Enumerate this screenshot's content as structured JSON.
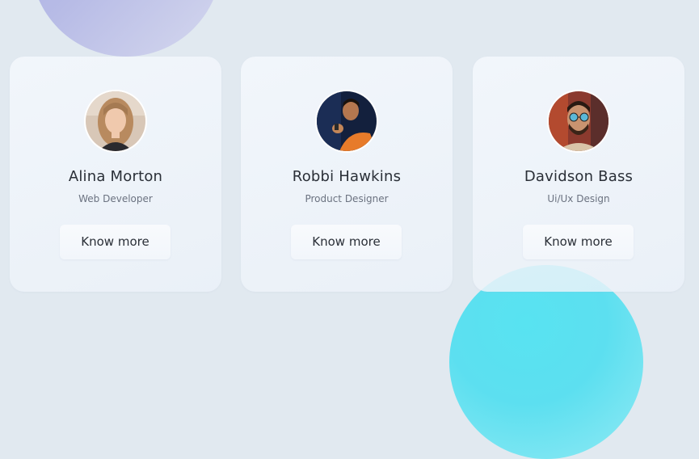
{
  "cards": [
    {
      "name": "Alina Morton",
      "role": "Web Developer",
      "button_label": "Know more",
      "avatar_icon": "person-photo-blonde-woman"
    },
    {
      "name": "Robbi Hawkins",
      "role": "Product Designer",
      "button_label": "Know more",
      "avatar_icon": "person-photo-man-orange-shirt"
    },
    {
      "name": "Davidson Bass",
      "role": "Ui/Ux Design",
      "button_label": "Know more",
      "avatar_icon": "person-photo-man-sunglasses"
    }
  ],
  "colors": {
    "background": "#e1e9f0",
    "blob_top": "#b7bbe6",
    "blob_bottom": "#5cdff0",
    "text_primary": "#2a2f37",
    "text_secondary": "#6b7280"
  }
}
